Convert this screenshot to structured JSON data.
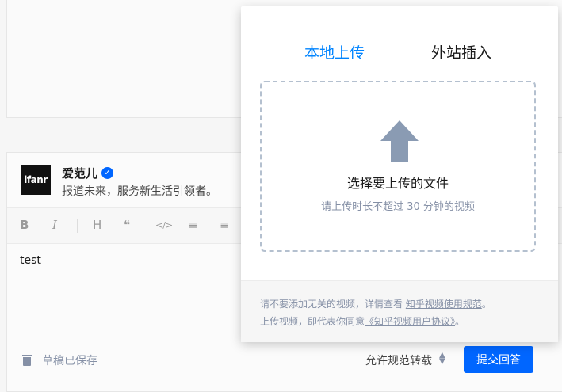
{
  "answer": {
    "author": {
      "name": "爱范儿",
      "bio": "报道未来，服务新生活引领者。",
      "avatar_text": "ifanr"
    },
    "toolbar": {
      "icons": [
        "bold-icon",
        "italic-icon",
        "heading-icon",
        "quote-icon",
        "code-icon",
        "ordered-list-icon",
        "unordered-list-icon"
      ],
      "labels": {
        "bold": "B",
        "italic": "I",
        "heading": "H",
        "quote": "❝",
        "code": "</>",
        "ol": "≡",
        "ul": "≡"
      }
    },
    "content": "test",
    "draft_status": "草稿已保存",
    "repost_option": "允许规范转载",
    "submit_label": "提交回答"
  },
  "upload_modal": {
    "tabs": [
      {
        "label": "本地上传",
        "active": true
      },
      {
        "label": "外站插入",
        "active": false
      }
    ],
    "dropzone": {
      "title": "选择要上传的文件",
      "hint": "请上传时长不超过 30 分钟的视频"
    },
    "footer": {
      "line1_prefix": "请不要添加无关的视频，详情查看 ",
      "line1_link": "知乎视频使用规范",
      "line1_suffix": "。",
      "line2_prefix": "上传视频，即代表你同意",
      "line2_link": "《知乎视频用户协议》",
      "line2_suffix": "。"
    }
  },
  "colors": {
    "accent": "#0084ff",
    "submit": "#0066ff",
    "muted": "#8590a6",
    "arrow": "#8590a6"
  }
}
